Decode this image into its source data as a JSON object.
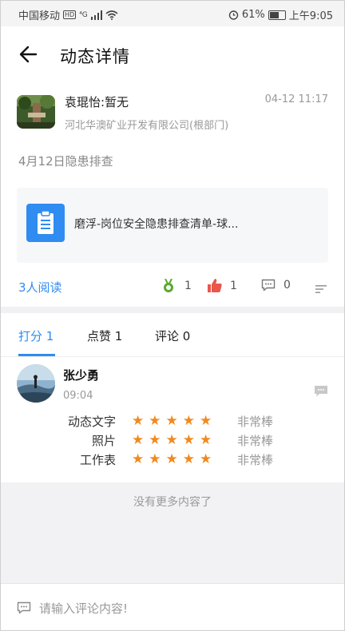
{
  "status_bar": {
    "carrier": "中国移动",
    "hd_label": "HD",
    "network": "⁴G",
    "battery_level": "61%",
    "battery_fraction": 0.61,
    "time": "上午9:05"
  },
  "header": {
    "title": "动态详情",
    "back_icon": "arrow-left-icon"
  },
  "post": {
    "author": "袁琨怡:暂无",
    "time": "04-12 11:17",
    "company": "河北华澳矿业开发有限公司(根部门)",
    "text": "4月12日隐患排查",
    "attachment": {
      "icon": "clipboard-icon",
      "name": "磨浮-岗位安全隐患排查清单-球..."
    },
    "read_count": "3人阅读",
    "stats": {
      "medal_count": "1",
      "like_count": "1",
      "comment_count": "0"
    }
  },
  "tabs": [
    {
      "label": "打分 1"
    },
    {
      "label": "点赞 1"
    },
    {
      "label": "评论 0"
    }
  ],
  "rating_entry": {
    "name": "张少勇",
    "time": "09:04",
    "rows": [
      {
        "label": "动态文字",
        "stars": 5,
        "text": "非常棒"
      },
      {
        "label": "照片",
        "stars": 5,
        "text": "非常棒"
      },
      {
        "label": "工作表",
        "stars": 5,
        "text": "非常棒"
      }
    ]
  },
  "no_more_text": "没有更多内容了",
  "comment_input": {
    "placeholder": "请输入评论内容!"
  },
  "colors": {
    "accent": "#2f8cf0",
    "star": "#f08a1f",
    "medal": "#5aaa2e",
    "like": "#e8574b"
  }
}
